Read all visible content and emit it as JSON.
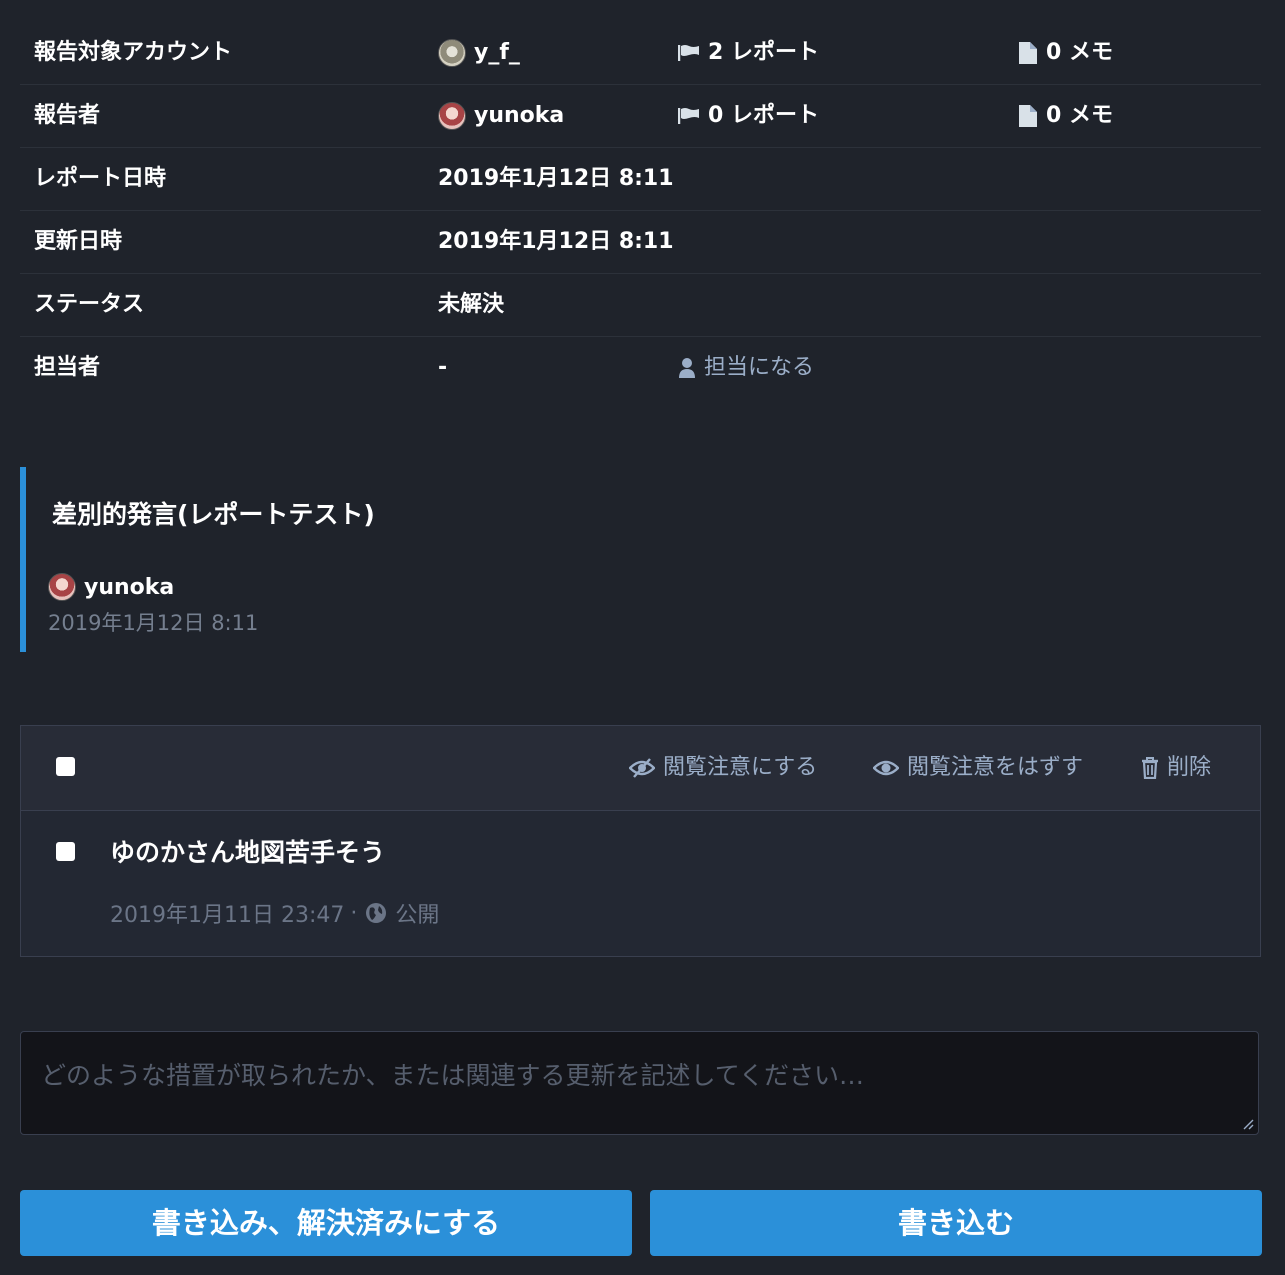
{
  "info": {
    "rows": [
      {
        "label": "報告対象アカウント",
        "value": "y_f_",
        "reports": "2 レポート",
        "memos": "0 メモ"
      },
      {
        "label": "報告者",
        "value": "yunoka",
        "reports": "0 レポート",
        "memos": "0 メモ"
      },
      {
        "label": "レポート日時",
        "value": "2019年1月12日 8:11"
      },
      {
        "label": "更新日時",
        "value": "2019年1月12日 8:11"
      },
      {
        "label": "ステータス",
        "value": "未解決"
      },
      {
        "label": "担当者",
        "value": "-",
        "assign_link": "担当になる"
      }
    ]
  },
  "report_comment": {
    "text": "差別的発言(レポートテスト)",
    "author": "yunoka",
    "date": "2019年1月12日 8:11"
  },
  "statuses_toolbar": {
    "mark_sensitive": "閲覧注意にする",
    "unmark_sensitive": "閲覧注意をはずす",
    "delete": "削除"
  },
  "statuses": [
    {
      "text": "ゆのかさん地図苦手そう",
      "date": "2019年1月11日 23:47",
      "separator": "·",
      "visibility": "公開"
    }
  ],
  "note": {
    "placeholder": "どのような措置が取られたか、または関連する更新を記述してください…"
  },
  "buttons": {
    "resolve": "書き込み、解決済みにする",
    "create": "書き込む"
  },
  "colors": {
    "background": "#1f232b",
    "accent": "#2b90d9",
    "link": "#9baec8"
  }
}
